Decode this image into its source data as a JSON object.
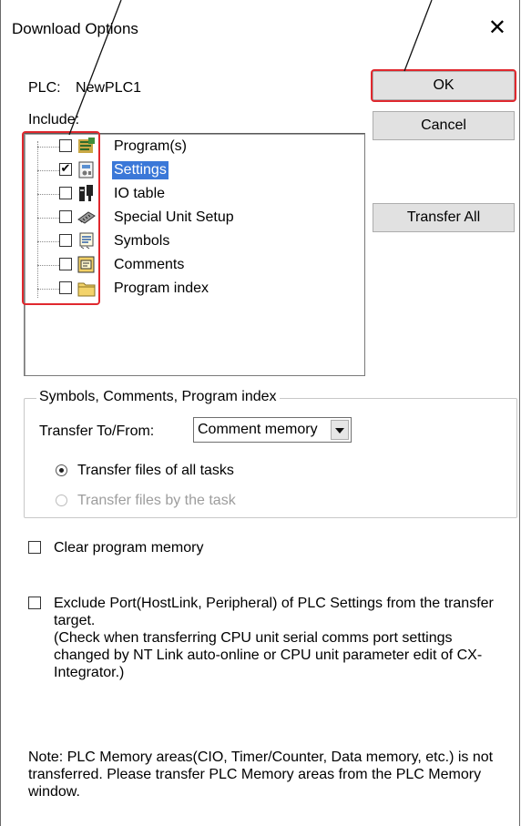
{
  "window": {
    "title": "Download Options",
    "close_glyph": "✕"
  },
  "plc": {
    "label": "PLC:",
    "name": "NewPLC1"
  },
  "include": {
    "label": "Include:",
    "items": [
      {
        "label": "Program(s)",
        "checked": false,
        "selected": false,
        "icon": "program-icon"
      },
      {
        "label": "Settings",
        "checked": true,
        "selected": true,
        "icon": "settings-icon"
      },
      {
        "label": "IO table",
        "checked": false,
        "selected": false,
        "icon": "io-table-icon"
      },
      {
        "label": "Special Unit Setup",
        "checked": false,
        "selected": false,
        "icon": "special-unit-icon"
      },
      {
        "label": "Symbols",
        "checked": false,
        "selected": false,
        "icon": "symbols-icon"
      },
      {
        "label": "Comments",
        "checked": false,
        "selected": false,
        "icon": "comments-icon"
      },
      {
        "label": "Program index",
        "checked": false,
        "selected": false,
        "icon": "folder-icon"
      }
    ]
  },
  "buttons": {
    "ok": "OK",
    "cancel": "Cancel",
    "transfer_all": "Transfer All"
  },
  "symbols_group": {
    "legend": "Symbols, Comments, Program index",
    "transfer_label": "Transfer To/From:",
    "transfer_value": "Comment memory",
    "radio_all": "Transfer files of all tasks",
    "radio_by_task": "Transfer files by the task",
    "selected_radio": "all"
  },
  "clear_memory": {
    "label": "Clear program memory",
    "checked": false
  },
  "exclude_port": {
    "label": "Exclude Port(HostLink, Peripheral) of PLC Settings from the transfer target.",
    "sublabel": "(Check when transferring CPU unit serial comms port settings changed by NT Link auto-online or CPU unit parameter edit of CX-Integrator.)",
    "checked": false
  },
  "note": "Note: PLC Memory areas(CIO, Timer/Counter, Data memory, etc.) is not transferred. Please transfer PLC Memory areas from the PLC Memory window.",
  "colors": {
    "highlight": "#e0282e",
    "selection": "#3b78d8"
  }
}
